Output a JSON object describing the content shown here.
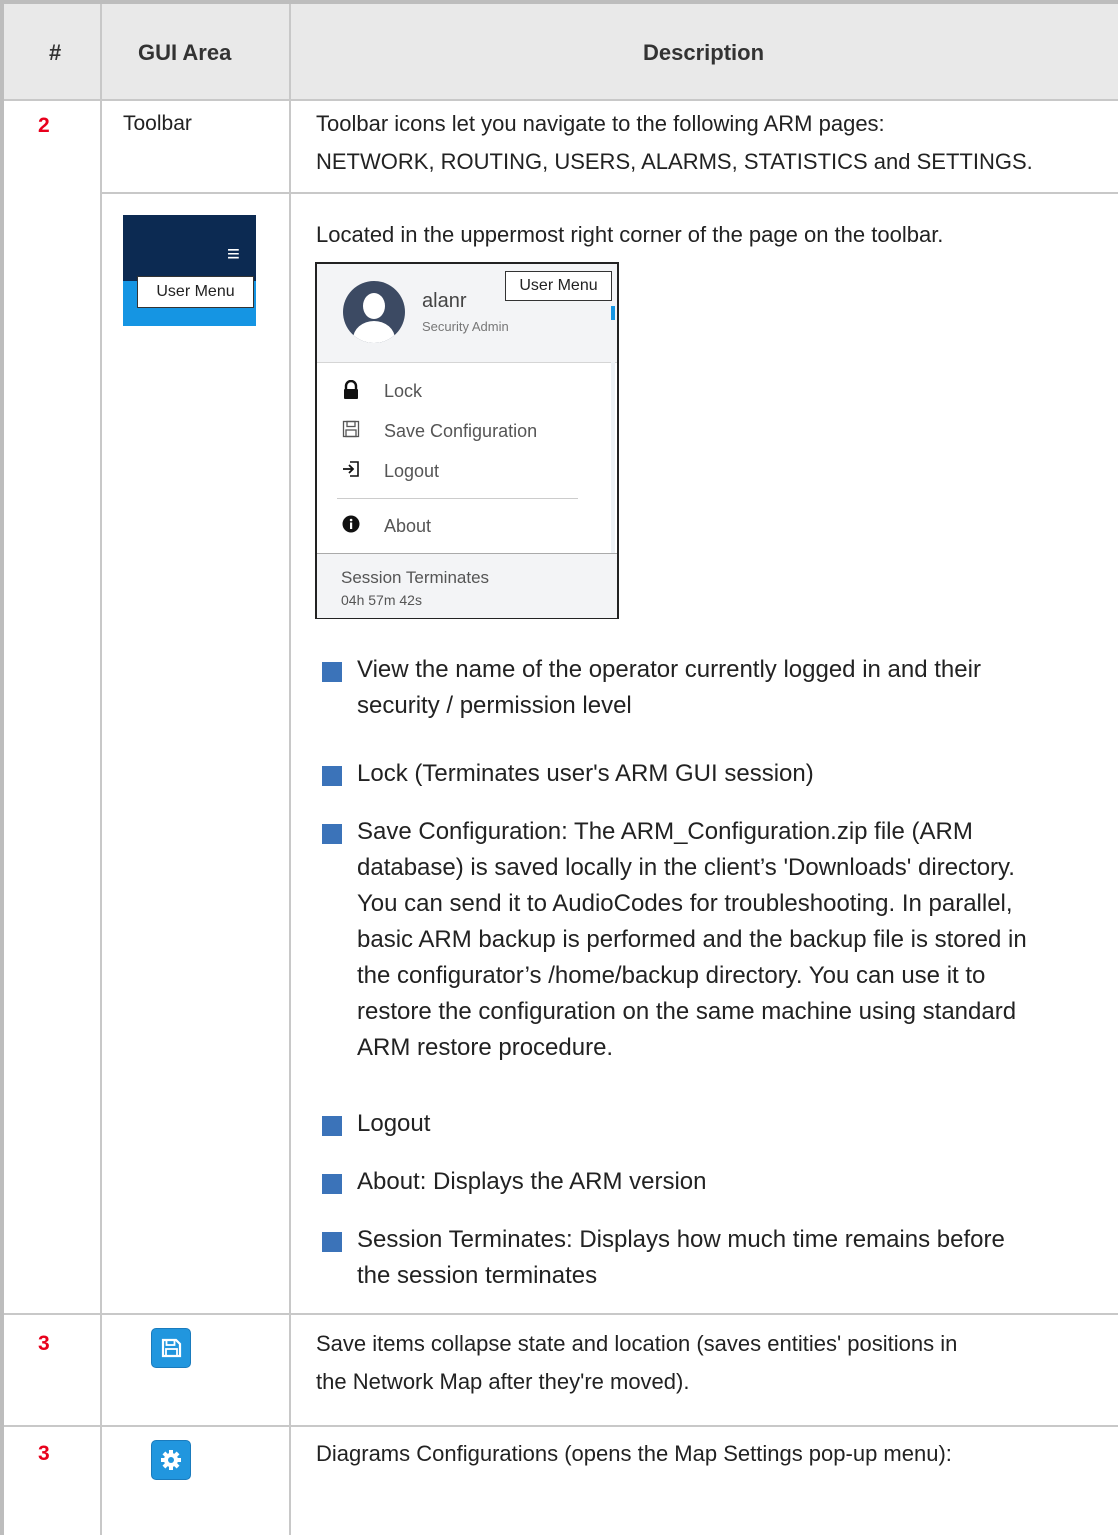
{
  "header": {
    "col1": "#",
    "col2": "GUI Area",
    "col3": "Description"
  },
  "rows": {
    "toolbar": {
      "number": "2",
      "area": "Toolbar",
      "desc_line1": "Toolbar icons let you navigate to the following ARM pages:",
      "desc_line2": "NETWORK, ROUTING, USERS, ALARMS, STATISTICS and SETTINGS."
    },
    "user_menu": {
      "thumb_tooltip": "User Menu",
      "intro": "Located in the uppermost right corner of the page on the toolbar.",
      "popup": {
        "tooltip": "User Menu",
        "username": "alanr",
        "role": "Security Admin",
        "items": [
          "Lock",
          "Save Configuration",
          "Logout",
          "About"
        ],
        "session_label": "Session Terminates",
        "session_time": "04h 57m 42s"
      },
      "bullets": [
        [
          "View the name of the operator currently logged in and their",
          "security / permission level"
        ],
        [
          "Lock (Terminates user's ARM GUI session)"
        ],
        [
          "Save Configuration: The ARM_Configuration.zip file (ARM",
          "database) is saved locally in the client’s 'Downloads' directory.",
          "You can send it to AudioCodes for troubleshooting. In parallel,",
          "basic ARM backup is performed and the backup file is stored in",
          "the configurator’s /home/backup directory. You can use it to",
          "restore the configuration on the same machine using standard",
          "ARM restore procedure."
        ],
        [
          "Logout"
        ],
        [
          "About: Displays the ARM version"
        ],
        [
          "Session Terminates: Displays how much time remains before",
          "the session terminates"
        ]
      ]
    },
    "save": {
      "number": "3",
      "desc_line1": "Save items collapse state and location (saves entities' positions in",
      "desc_line2": "the Network Map after they're moved)."
    },
    "diagram": {
      "number": "3",
      "desc_line1": "Diagrams Configurations (opens the Map Settings pop-up menu):"
    }
  }
}
